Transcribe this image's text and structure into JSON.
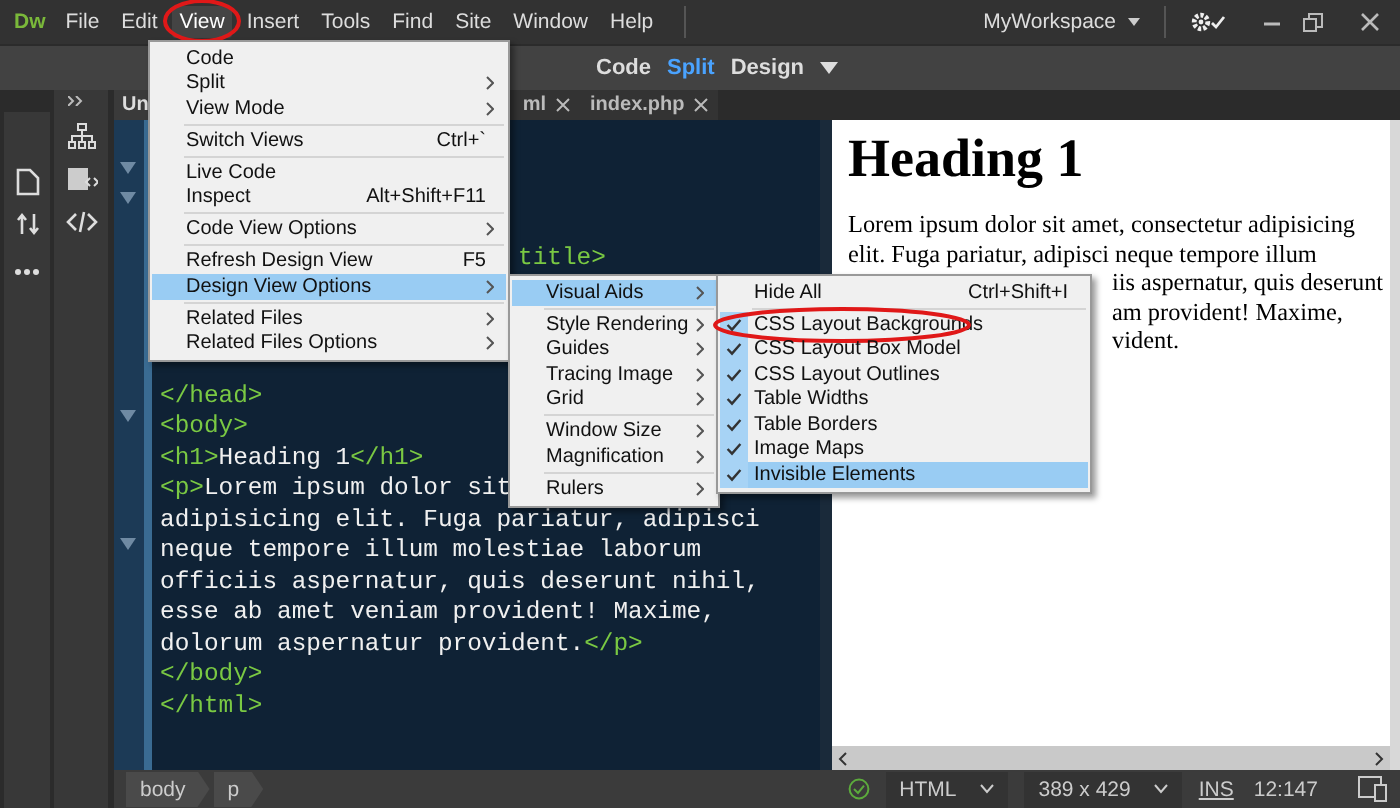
{
  "menubar": {
    "logo": "Dw",
    "items": [
      {
        "label": "File",
        "selected": false,
        "circled": false
      },
      {
        "label": "Edit",
        "selected": false,
        "circled": false
      },
      {
        "label": "View",
        "selected": true,
        "circled": true
      },
      {
        "label": "Insert",
        "selected": false,
        "circled": false
      },
      {
        "label": "Tools",
        "selected": false,
        "circled": false
      },
      {
        "label": "Find",
        "selected": false,
        "circled": false
      },
      {
        "label": "Site",
        "selected": false,
        "circled": false
      },
      {
        "label": "Window",
        "selected": false,
        "circled": false
      },
      {
        "label": "Help",
        "selected": false,
        "circled": false
      }
    ],
    "workspace": "MyWorkspace"
  },
  "toolbar": {
    "views": [
      {
        "label": "Code",
        "selected": false
      },
      {
        "label": "Split",
        "selected": true
      },
      {
        "label": "Design",
        "selected": false
      }
    ]
  },
  "tabs": [
    {
      "label": "Un",
      "closable": false,
      "selected": true
    },
    {
      "label": "ml",
      "closable": true,
      "selected": false
    },
    {
      "label": "index.php",
      "closable": true,
      "selected": false
    }
  ],
  "code_editor": {
    "lines": [
      {
        "kind": "partial",
        "segments": [
          {
            "kind": "tag",
            "text": "title>"
          }
        ]
      },
      {
        "kind": "code",
        "segments": [
          {
            "kind": "tag",
            "text": "</head>"
          }
        ]
      },
      {
        "kind": "code",
        "segments": [
          {
            "kind": "tag",
            "text": "<body>"
          }
        ]
      },
      {
        "kind": "code",
        "segments": [
          {
            "kind": "tag",
            "text": "<h1>"
          },
          {
            "kind": "text",
            "text": "Heading 1"
          },
          {
            "kind": "tag",
            "text": "</h1>"
          }
        ]
      },
      {
        "kind": "code",
        "segments": [
          {
            "kind": "tag",
            "text": "<p>"
          },
          {
            "kind": "text",
            "text": "Lorem ipsum dolor sit"
          }
        ]
      },
      {
        "kind": "code",
        "segments": [
          {
            "kind": "text",
            "text": "adipisicing elit. Fuga pariatur, adipisci"
          }
        ]
      },
      {
        "kind": "code",
        "segments": [
          {
            "kind": "text",
            "text": "neque tempore illum molestiae laborum"
          }
        ]
      },
      {
        "kind": "code",
        "segments": [
          {
            "kind": "text",
            "text": "officiis aspernatur, quis deserunt nihil,"
          }
        ]
      },
      {
        "kind": "code",
        "segments": [
          {
            "kind": "text",
            "text": "esse ab amet veniam provident! Maxime,"
          }
        ]
      },
      {
        "kind": "code",
        "segments": [
          {
            "kind": "text",
            "text": "dolorum aspernatur provident."
          },
          {
            "kind": "tag",
            "text": "</p>"
          }
        ]
      },
      {
        "kind": "code",
        "segments": [
          {
            "kind": "tag",
            "text": "</body>"
          }
        ]
      },
      {
        "kind": "code",
        "segments": [
          {
            "kind": "tag",
            "text": "</html>"
          }
        ]
      }
    ]
  },
  "design_view": {
    "heading": "Heading 1",
    "paragraph_lines": [
      {
        "kind": "full",
        "text": "Lorem ipsum dolor sit amet, consectetur adipisicing"
      },
      {
        "kind": "full",
        "text": "elit. Fuga pariatur, adipisci neque tempore illum"
      },
      {
        "kind": "partial",
        "text": "iis aspernatur, quis deserunt"
      },
      {
        "kind": "partial",
        "text": "am provident! Maxime,"
      },
      {
        "kind": "partial",
        "text": "vident."
      }
    ]
  },
  "view_menu": {
    "items": [
      {
        "kind": "item",
        "label": "Code",
        "submenu": false,
        "selected": false
      },
      {
        "kind": "item",
        "label": "Split",
        "submenu": true,
        "selected": false
      },
      {
        "kind": "item",
        "label": "View Mode",
        "submenu": true,
        "selected": false
      },
      {
        "kind": "separator"
      },
      {
        "kind": "item",
        "label": "Switch Views",
        "shortcut": "Ctrl+`",
        "submenu": false,
        "selected": false
      },
      {
        "kind": "separator"
      },
      {
        "kind": "item",
        "label": "Live Code",
        "submenu": false,
        "selected": false
      },
      {
        "kind": "item",
        "label": "Inspect",
        "shortcut": "Alt+Shift+F11",
        "submenu": false,
        "selected": false
      },
      {
        "kind": "separator"
      },
      {
        "kind": "item",
        "label": "Code View Options",
        "submenu": true,
        "selected": false
      },
      {
        "kind": "separator"
      },
      {
        "kind": "item",
        "label": "Refresh Design View",
        "shortcut": "F5",
        "submenu": false,
        "selected": false
      },
      {
        "kind": "item",
        "label": "Design View Options",
        "submenu": true,
        "selected": true
      },
      {
        "kind": "separator"
      },
      {
        "kind": "item",
        "label": "Related Files",
        "submenu": true,
        "selected": false
      },
      {
        "kind": "item",
        "label": "Related Files Options",
        "submenu": true,
        "selected": false
      }
    ]
  },
  "design_view_options_menu": {
    "items": [
      {
        "kind": "item",
        "label": "Visual Aids",
        "submenu": true,
        "selected": true
      },
      {
        "kind": "separator"
      },
      {
        "kind": "item",
        "label": "Style Rendering",
        "submenu": true,
        "selected": false
      },
      {
        "kind": "item",
        "label": "Guides",
        "submenu": true,
        "selected": false
      },
      {
        "kind": "item",
        "label": "Tracing Image",
        "submenu": true,
        "selected": false
      },
      {
        "kind": "item",
        "label": "Grid",
        "submenu": true,
        "selected": false
      },
      {
        "kind": "separator"
      },
      {
        "kind": "item",
        "label": "Window Size",
        "submenu": true,
        "selected": false
      },
      {
        "kind": "item",
        "label": "Magnification",
        "submenu": true,
        "selected": false
      },
      {
        "kind": "separator"
      },
      {
        "kind": "item",
        "label": "Rulers",
        "submenu": true,
        "selected": false
      }
    ]
  },
  "visual_aids_menu": {
    "items": [
      {
        "kind": "item",
        "label": "Hide All",
        "shortcut": "Ctrl+Shift+I",
        "checked": false,
        "selected": false,
        "circled": false
      },
      {
        "kind": "separator"
      },
      {
        "kind": "item",
        "label": "CSS Layout Backgrounds",
        "checked": true,
        "selected": false,
        "circled": true
      },
      {
        "kind": "item",
        "label": "CSS Layout Box Model",
        "checked": true,
        "selected": false,
        "circled": false
      },
      {
        "kind": "item",
        "label": "CSS Layout Outlines",
        "checked": true,
        "selected": false,
        "circled": false
      },
      {
        "kind": "item",
        "label": "Table Widths",
        "checked": true,
        "selected": false,
        "circled": false
      },
      {
        "kind": "item",
        "label": "Table Borders",
        "checked": true,
        "selected": false,
        "circled": false
      },
      {
        "kind": "item",
        "label": "Image Maps",
        "checked": true,
        "selected": false,
        "circled": false
      },
      {
        "kind": "item",
        "label": "Invisible Elements",
        "checked": true,
        "selected": true,
        "circled": false
      }
    ]
  },
  "status_bar": {
    "breadcrumbs": [
      "body",
      "p"
    ],
    "document_type": "HTML",
    "size": "389 x 429",
    "mode": "INS",
    "position": "12:147"
  }
}
